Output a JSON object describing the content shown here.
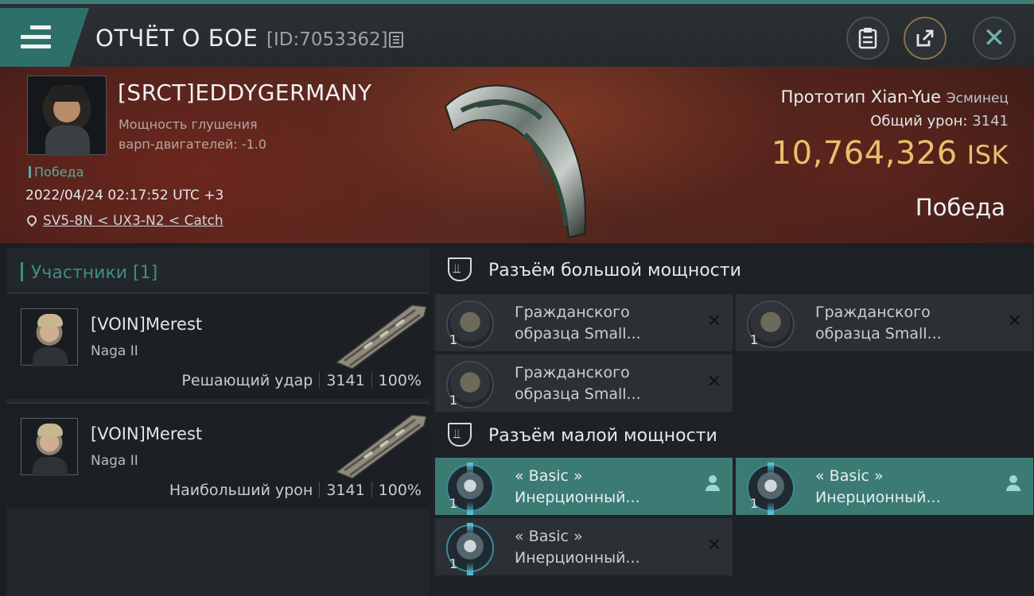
{
  "header": {
    "title": "ОТЧЁТ О БОЕ",
    "report_id": "[ID:7053362]"
  },
  "victim": {
    "name": "[SRCT]EDDYGERMANY",
    "attribute_line1": "Мощность глушения",
    "attribute_line2": "варп-двигателей: -1.0",
    "status": "Победа",
    "datetime": "2022/04/24 02:17:52 UTC +3",
    "location": "SV5-8N < UX3-N2 < Catch",
    "ship_name": "Прототип Xian-Yue",
    "ship_class": "Эсминец",
    "total_damage_label": "Общий урон:",
    "total_damage_value": "3141",
    "isk_value": "10,764,326",
    "isk_unit": "ISK",
    "outcome": "Победа"
  },
  "participants": {
    "header": "Участники [1]",
    "rows": [
      {
        "name": "[VOIN]Merest",
        "ship": "Naga II",
        "role": "Решающий удар",
        "damage": "3141",
        "percent": "100%"
      },
      {
        "name": "[VOIN]Merest",
        "ship": "Naga II",
        "role": "Наибольший урон",
        "damage": "3141",
        "percent": "100%"
      }
    ]
  },
  "fittings": {
    "high_slot": {
      "label": "Разъём большой мощности",
      "modules": [
        {
          "line1": "Гражданского",
          "line2": "образца Small...",
          "qty": "1",
          "state": "destroyed"
        },
        {
          "line1": "Гражданского",
          "line2": "образца Small...",
          "qty": "1",
          "state": "destroyed"
        },
        {
          "line1": "Гражданского",
          "line2": "образца Small...",
          "qty": "1",
          "state": "destroyed"
        }
      ]
    },
    "low_slot": {
      "label": "Разъём малой мощности",
      "modules": [
        {
          "line1": "« Basic »",
          "line2": "Инерционный...",
          "qty": "1",
          "state": "dropped"
        },
        {
          "line1": "« Basic »",
          "line2": "Инерционный...",
          "qty": "1",
          "state": "dropped"
        },
        {
          "line1": "« Basic »",
          "line2": "Инерционный...",
          "qty": "1",
          "state": "destroyed"
        }
      ]
    }
  },
  "icons": {
    "menu": "hamburger-menu-icon",
    "copy": "copy-icon",
    "clipboard": "clipboard-icon",
    "share": "share-icon",
    "close": "close-icon",
    "location": "location-pin-icon",
    "slot": "slot-shield-icon",
    "destroyed": "x-icon",
    "dropped": "person-icon"
  },
  "colors": {
    "accent": "#3d7f78",
    "isk": "#e8c06a",
    "banner": "#5a2a20",
    "active_module": "#3c7a74"
  }
}
